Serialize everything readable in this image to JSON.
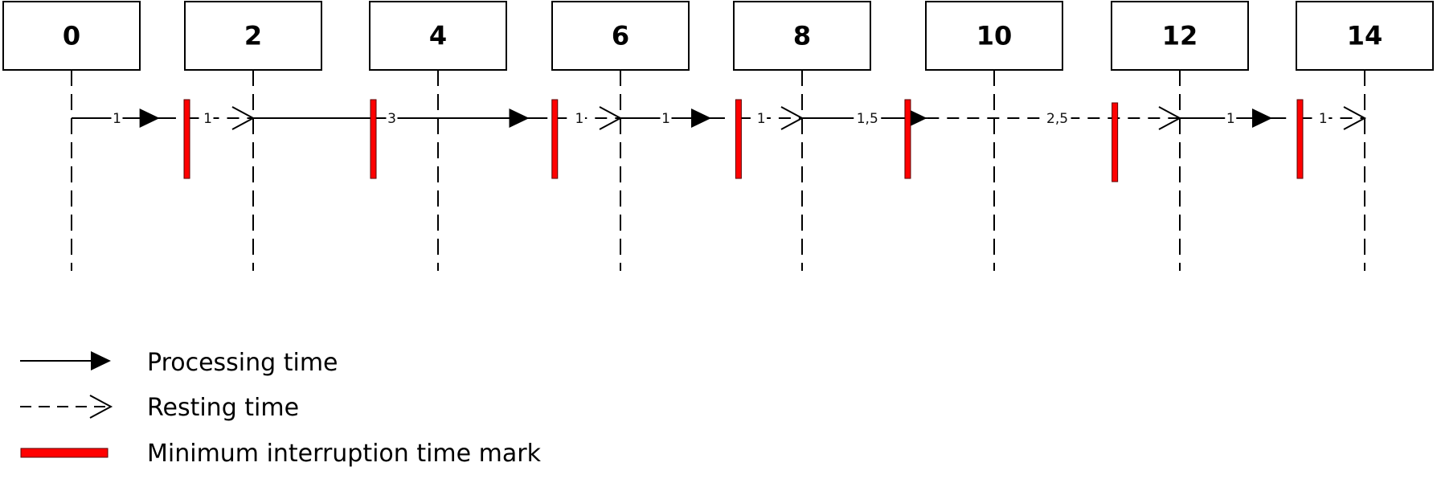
{
  "diagram": {
    "title": "",
    "time_ticks": [
      "0",
      "2",
      "4",
      "6",
      "8",
      "10",
      "12",
      "14"
    ],
    "tick_values": [
      0,
      2,
      4,
      6,
      8,
      10,
      12,
      14
    ],
    "colors": {
      "line": "#000000",
      "interruption_mark": "#ff0000",
      "interruption_mark_outline": "#5a0000"
    },
    "segments": [
      {
        "type": "processing",
        "from": 0,
        "to": 1.15,
        "label": "1",
        "label_at": 0.5,
        "arrow_at": 0.97
      },
      {
        "type": "resting",
        "from": 1.27,
        "to": 2,
        "label": "1",
        "label_at": 1.5,
        "arrow_at": 2
      },
      {
        "type": "processing",
        "from": 2,
        "to": 5.2,
        "label": "3",
        "label_at": 3.5,
        "arrow_at": 5.0
      },
      {
        "type": "resting",
        "from": 5.28,
        "to": 6,
        "label": "1",
        "label_at": 5.55,
        "arrow_at": 6
      },
      {
        "type": "processing",
        "from": 6,
        "to": 7.15,
        "label": "1",
        "label_at": 6.5,
        "arrow_at": 7.0
      },
      {
        "type": "resting",
        "from": 7.3,
        "to": 8,
        "label": "1",
        "label_at": 7.55,
        "arrow_at": 8
      },
      {
        "type": "processing",
        "from": 8,
        "to": 9.3,
        "label": "1,5",
        "label_at": 8.68,
        "arrow_at": 9.3
      },
      {
        "type": "resting",
        "from": 9.3,
        "to": 12,
        "label": "2,5",
        "label_at": 10.68,
        "arrow_at": 12
      },
      {
        "type": "processing",
        "from": 12,
        "to": 13.15,
        "label": "1",
        "label_at": 12.55,
        "arrow_at": 13.0
      },
      {
        "type": "resting",
        "from": 13.3,
        "to": 14,
        "label": "1",
        "label_at": 13.55,
        "arrow_at": 14
      }
    ],
    "interruption_marks": [
      1.27,
      3.3,
      5.28,
      7.3,
      9.1,
      11.3,
      13.3
    ]
  },
  "legend": {
    "items": [
      {
        "kind": "processing",
        "label": "Processing time"
      },
      {
        "kind": "resting",
        "label": "Resting time"
      },
      {
        "kind": "interruption",
        "label": "Minimum interruption time mark"
      }
    ]
  }
}
